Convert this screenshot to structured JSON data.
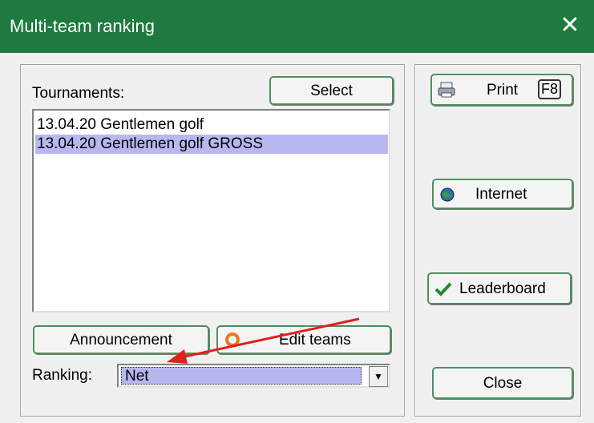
{
  "window": {
    "title": "Multi-team ranking",
    "close_glyph": "✕"
  },
  "tournaments": {
    "label": "Tournaments:",
    "select_button": "Select",
    "items": [
      {
        "text": "13.04.20 Gentlemen golf",
        "selected": false
      },
      {
        "text": "13.04.20 Gentlemen golf GROSS",
        "selected": true
      }
    ]
  },
  "buttons": {
    "announcement": "Announcement",
    "edit_teams": "Edit teams",
    "print": "Print",
    "print_shortcut": "F8",
    "internet": "Internet",
    "leaderboard": "Leaderboard",
    "close": "Close"
  },
  "ranking": {
    "label": "Ranking:",
    "value": "Net"
  },
  "icons": {
    "print": "printer-icon",
    "internet": "globe-icon",
    "leaderboard": "checkmark-icon",
    "edit_teams": "ring-icon"
  },
  "colors": {
    "titlebar": "#1f7a3f",
    "button_border": "#4d8f5e",
    "selection": "#b8b7f0",
    "annotation_arrow": "#e0201a"
  }
}
